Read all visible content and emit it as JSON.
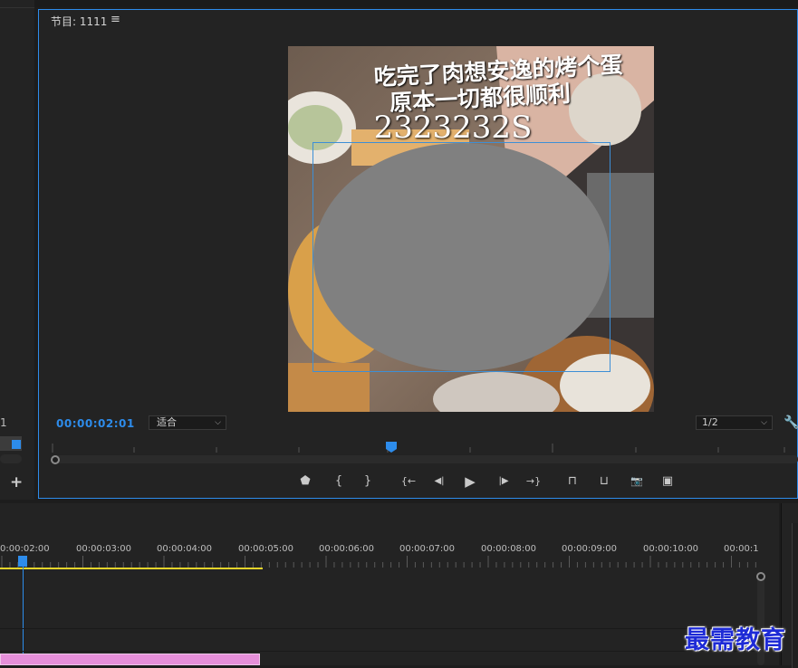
{
  "monitor": {
    "title": "节目: 1111",
    "menu_icon": "≡",
    "timecode": "00:00:02:01",
    "zoom": "适合",
    "resolution": "1/2"
  },
  "video": {
    "caption_line1": "吃完了肉想安逸的烤个蛋",
    "caption_line2": "原本一切都很顺利",
    "caption_line3": "2323232S"
  },
  "left_panel": {
    "partial_number": "1",
    "add_label": "+"
  },
  "transport": [
    {
      "icon": "marker-icon",
      "glyph": "⬟"
    },
    {
      "icon": "mark-in-icon",
      "glyph": "{"
    },
    {
      "icon": "mark-out-icon",
      "glyph": "}"
    },
    {
      "icon": "go-to-in-icon",
      "glyph": "{←"
    },
    {
      "icon": "step-back-icon",
      "glyph": "◀|"
    },
    {
      "icon": "play-icon",
      "glyph": "▶"
    },
    {
      "icon": "step-forward-icon",
      "glyph": "|▶"
    },
    {
      "icon": "go-to-out-icon",
      "glyph": "→}"
    },
    {
      "icon": "lift-icon",
      "glyph": "⊓"
    },
    {
      "icon": "extract-icon",
      "glyph": "⊔"
    },
    {
      "icon": "export-frame-icon",
      "glyph": "📷"
    },
    {
      "icon": "compare-view-icon",
      "glyph": "▣"
    }
  ],
  "timeline": {
    "timecodes": [
      "0:00:02:00",
      "00:00:03:00",
      "00:00:04:00",
      "00:00:05:00",
      "00:00:06:00",
      "00:00:07:00",
      "00:00:08:00",
      "00:00:09:00",
      "00:00:10:00",
      "00:00:1"
    ]
  },
  "watermark": "最需教育",
  "colors": {
    "accent": "#2d8ceb",
    "work_area": "#e3d32a",
    "clip": "#e58fd9",
    "mask_fill": "#808080"
  }
}
